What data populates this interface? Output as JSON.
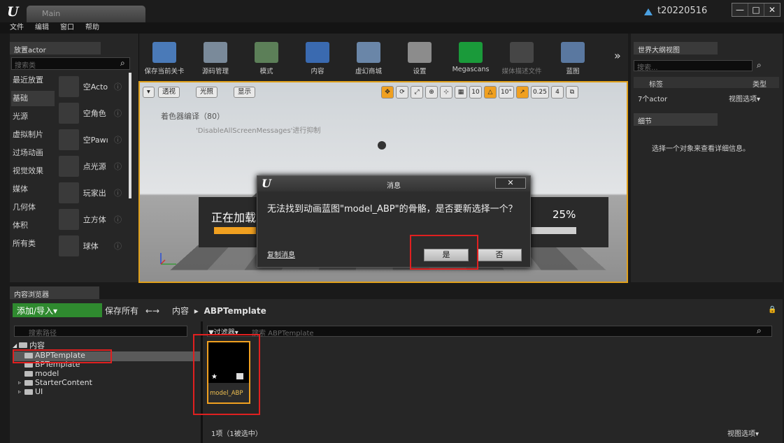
{
  "window": {
    "tab": "Main",
    "project": "t20220516",
    "controls": [
      "—",
      "□",
      "✕"
    ]
  },
  "menu": [
    "文件",
    "编辑",
    "窗口",
    "帮助"
  ],
  "place": {
    "tab": "放置actor",
    "search_placeholder": "搜索类",
    "categories": [
      "最近放置",
      "基础",
      "光源",
      "虚拟制片",
      "过场动画",
      "视觉效果",
      "媒体",
      "几何体",
      "体积",
      "所有类"
    ],
    "active_category": "基础",
    "items": [
      "空Acto",
      "空角色",
      "空Pawı",
      "点光源",
      "玩家出",
      "立方体",
      "球体"
    ]
  },
  "toolbar": {
    "buttons": [
      {
        "label": "保存当前关卡",
        "enabled": true
      },
      {
        "label": "源码管理",
        "enabled": true
      },
      {
        "label": "模式",
        "enabled": true
      },
      {
        "label": "内容",
        "enabled": true
      },
      {
        "label": "虚幻商城",
        "enabled": true
      },
      {
        "label": "设置",
        "enabled": true
      },
      {
        "label": "Megascans",
        "enabled": true
      },
      {
        "label": "媒体描述文件",
        "enabled": false
      },
      {
        "label": "蓝图",
        "enabled": true
      }
    ],
    "more": "»"
  },
  "viewport": {
    "buttons": [
      "▾",
      "透视",
      "光照",
      "显示"
    ],
    "tools": [
      "✥",
      "⟳",
      "⤢",
      "⊕",
      "⊹",
      "▦",
      "10",
      "△",
      "10°",
      "↗",
      "0.25",
      "4",
      "⧉"
    ],
    "shader_text": "着色器编译（80）",
    "disable_text": "'DisableAllScreenMessages'进行抑制",
    "loading_text": "正在加载",
    "loading_pct": "25%",
    "loading_progress": 0.25
  },
  "dialog": {
    "caption": "消息",
    "close": "✕",
    "message": "无法找到动画蓝图\"model_ABP\"的骨骼，是否要新选择一个？",
    "copy": "复制消息",
    "yes": "是",
    "no": "否"
  },
  "outliner": {
    "tab": "世界大纲视图",
    "search_placeholder": "搜索...",
    "col_label": "标签",
    "col_type": "类型",
    "count": "7个actor",
    "view_options": "视图选项▾"
  },
  "details": {
    "tab": "细节",
    "hint": "选择一个对象来查看详细信息。"
  },
  "content_browser": {
    "tab": "内容浏览器",
    "add": "添加/导入▾",
    "save_all": "保存所有",
    "nav_arrows": "←→",
    "path_root": "内容",
    "path_sep": "▸",
    "path_current": "ABPTemplate",
    "path_search_placeholder": "搜索路径",
    "tree": [
      {
        "label": "内容",
        "indent": 0,
        "prefix": "◢"
      },
      {
        "label": "ABPTemplate",
        "indent": 1,
        "prefix": ""
      },
      {
        "label": "BPTemplate",
        "indent": 1,
        "prefix": ""
      },
      {
        "label": "model",
        "indent": 1,
        "prefix": ""
      },
      {
        "label": "StarterContent",
        "indent": 1,
        "prefix": "▹"
      },
      {
        "label": "UI",
        "indent": 1,
        "prefix": "▹"
      }
    ],
    "filter": "▼过滤器▾",
    "asset_search_placeholder": "搜索 ABPTemplate",
    "asset_name": "model_ABP",
    "count": "1项（1被选中）",
    "view_options": "视图选项▾"
  },
  "colors": {
    "accent": "#f0a020",
    "highlight": "#e02020",
    "add_button": "#2f8a2f"
  }
}
